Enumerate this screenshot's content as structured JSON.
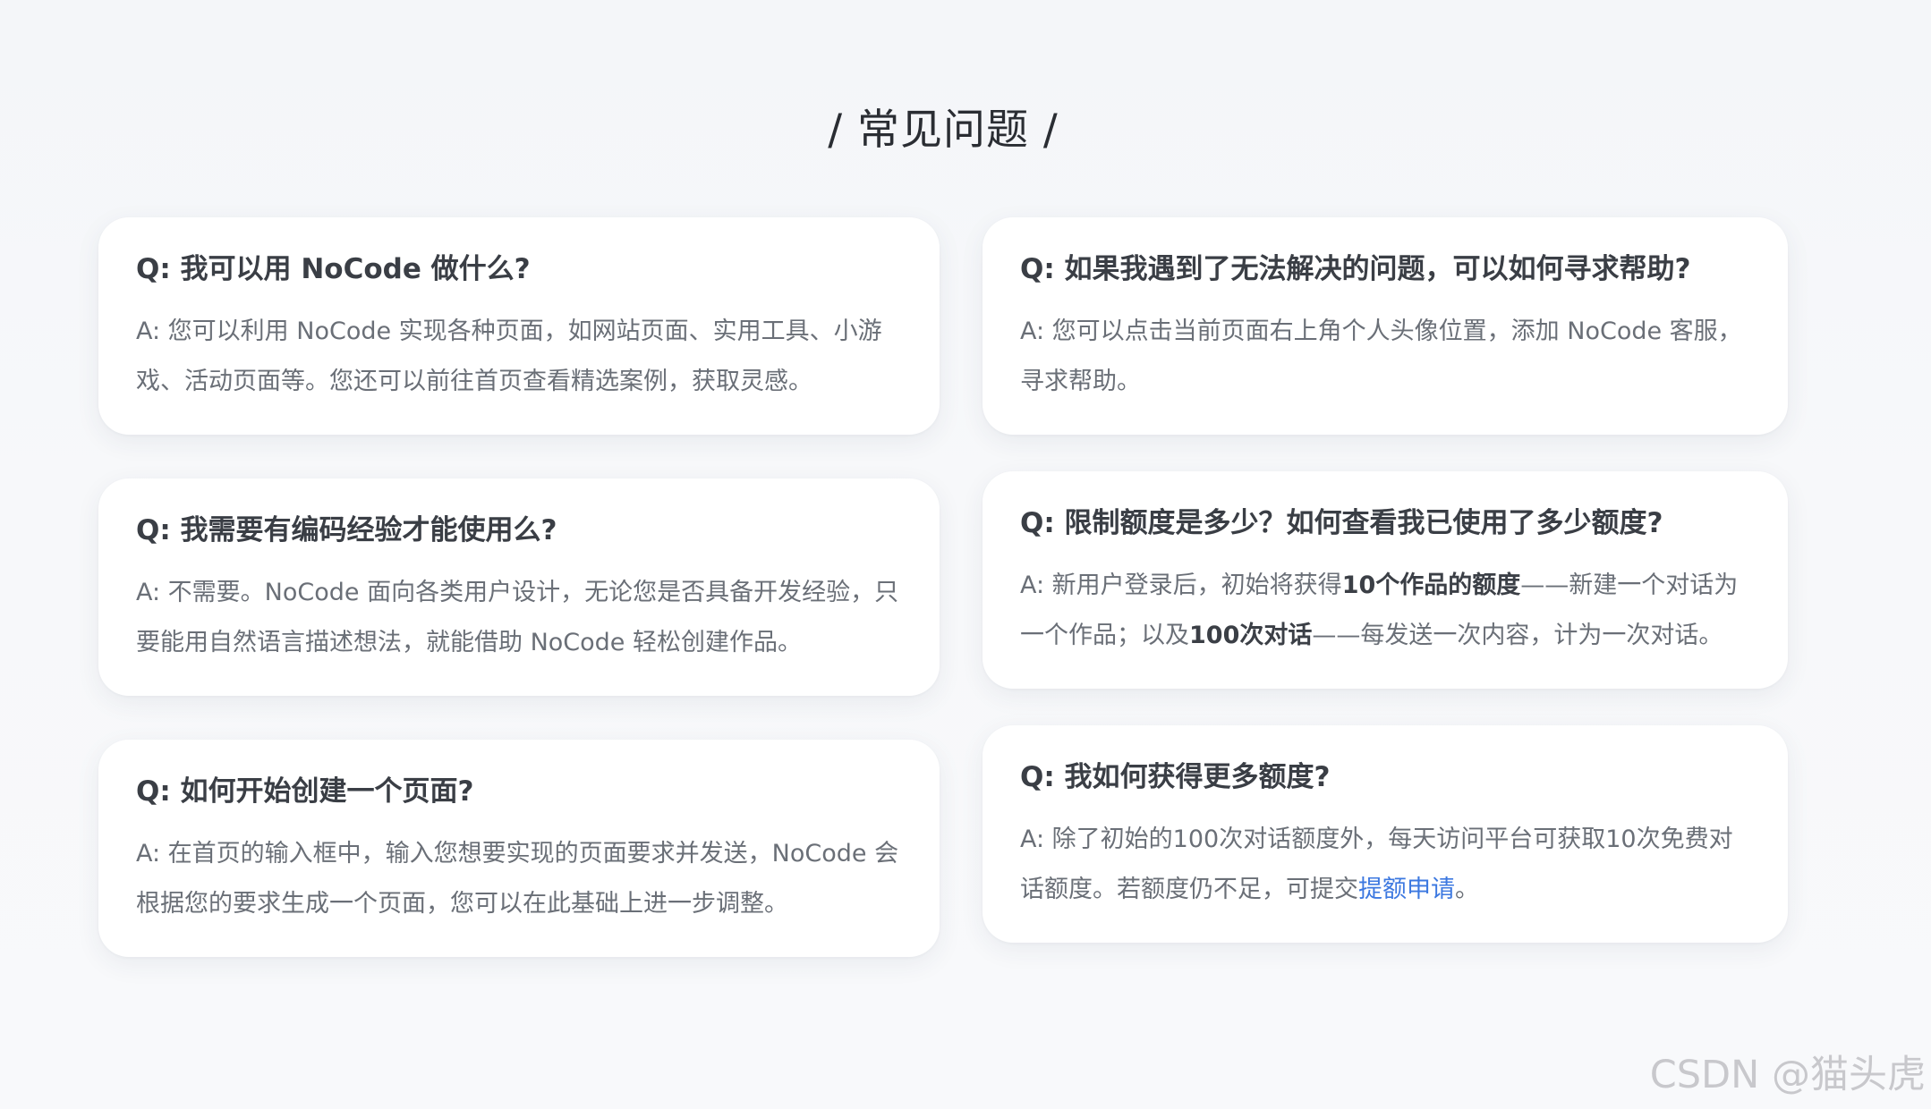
{
  "page_title": "/ 常见问题 /",
  "faq": [
    {
      "question": "Q: 我可以用 NoCode 做什么?",
      "answer": "A: 您可以利用 NoCode 实现各种页面，如网站页面、实用工具、小游戏、活动页面等。您还可以前往首页查看精选案例，获取灵感。"
    },
    {
      "question": "Q: 我需要有编码经验才能使用么?",
      "answer": "A: 不需要。NoCode 面向各类用户设计，无论您是否具备开发经验，只要能用自然语言描述想法，就能借助 NoCode 轻松创建作品。"
    },
    {
      "question": "Q: 如何开始创建一个页面?",
      "answer": "A: 在首页的输入框中，输入您想要实现的页面要求并发送，NoCode 会根据您的要求生成一个页面，您可以在此基础上进一步调整。"
    },
    {
      "question": "Q: 如果我遇到了无法解决的问题，可以如何寻求帮助?",
      "answer": "A: 您可以点击当前页面右上角个人头像位置，添加 NoCode 客服，寻求帮助。"
    },
    {
      "question": "Q: 限制额度是多少？如何查看我已使用了多少额度?",
      "answer_parts": {
        "p1": "A: 新用户登录后，初始将获得",
        "b1": "10个作品的额度",
        "p2": "——新建一个对话为一个作品；以及",
        "b2": "100次对话",
        "p3": "——每发送一次内容，计为一次对话。"
      }
    },
    {
      "question": "Q: 我如何获得更多额度?",
      "answer_parts": {
        "p1": "A: 除了初始的100次对话额度外，每天访问平台可获取10次免费对话额度。若额度仍不足，可提交",
        "link": "提额申请",
        "p2": "。"
      }
    }
  ],
  "watermark": "CSDN @猫头虎",
  "colors": {
    "link": "#3c78e0",
    "card_bg": "#ffffff",
    "page_bg": "#f6f7f9"
  }
}
